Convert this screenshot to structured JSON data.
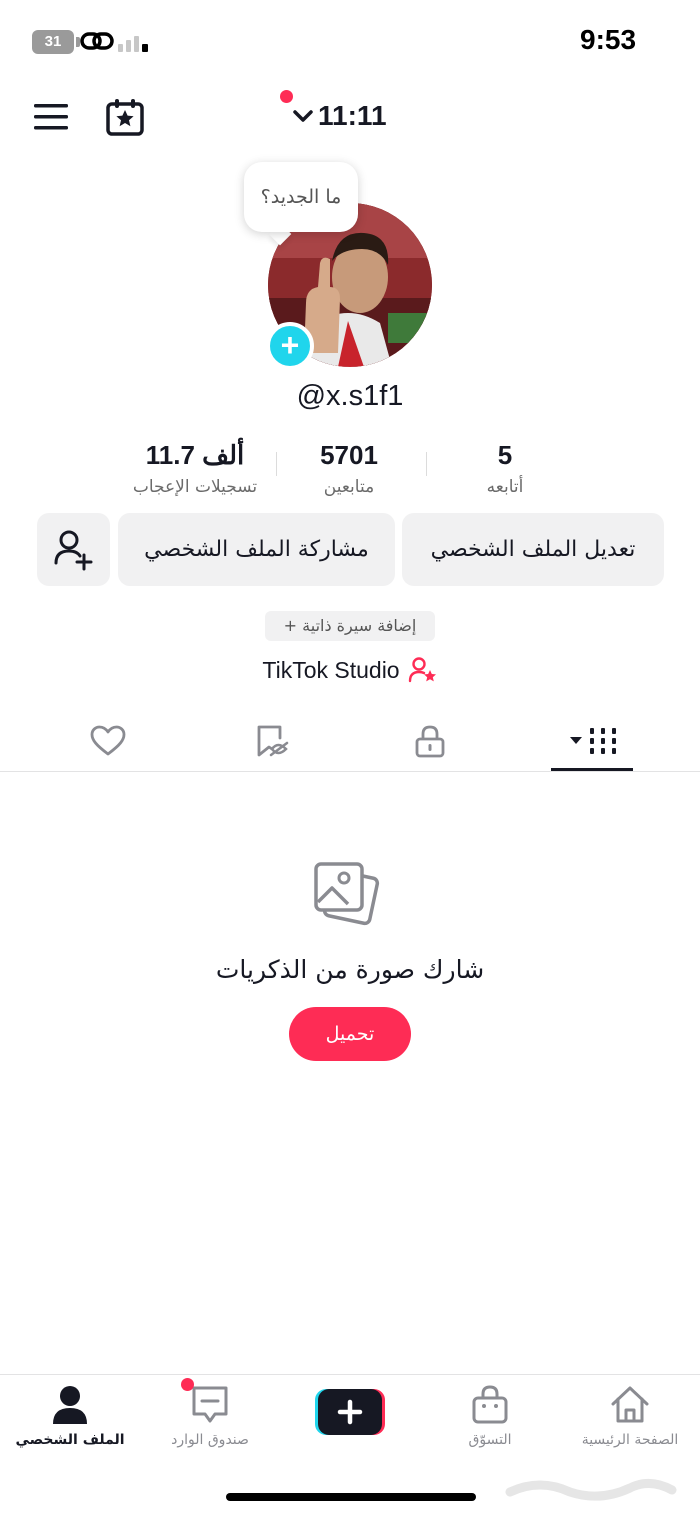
{
  "status_bar": {
    "time": "9:53",
    "battery": "31"
  },
  "header": {
    "title": "11:11"
  },
  "profile": {
    "bubble": "ما الجديد؟",
    "username": "@x.s1f1",
    "stats": [
      {
        "value": "11.7 ألف",
        "label": "تسجيلات الإعجاب"
      },
      {
        "value": "5701",
        "label": "متابعين"
      },
      {
        "value": "5",
        "label": "أتابعه"
      }
    ],
    "buttons": {
      "share": "مشاركة الملف الشخصي",
      "edit": "تعديل الملف الشخصي"
    },
    "bio": "+ إضافة سيرة ذاتية",
    "studio": "TikTok Studio"
  },
  "tabs": [
    "liked-heart-icon",
    "favorites-icon",
    "private-lock-icon",
    "videos-grid-icon"
  ],
  "empty_state": {
    "text": "شارك صورة من الذكريات",
    "button": "تحميل"
  },
  "nav": {
    "profile": "الملف الشخصي",
    "inbox": "صندوق الوارد",
    "shop": "التسوّق",
    "home": "الصفحة الرئيسية"
  },
  "colors": {
    "accent": "#fe2c55",
    "cyan": "#20d5ec",
    "text": "#161823"
  }
}
